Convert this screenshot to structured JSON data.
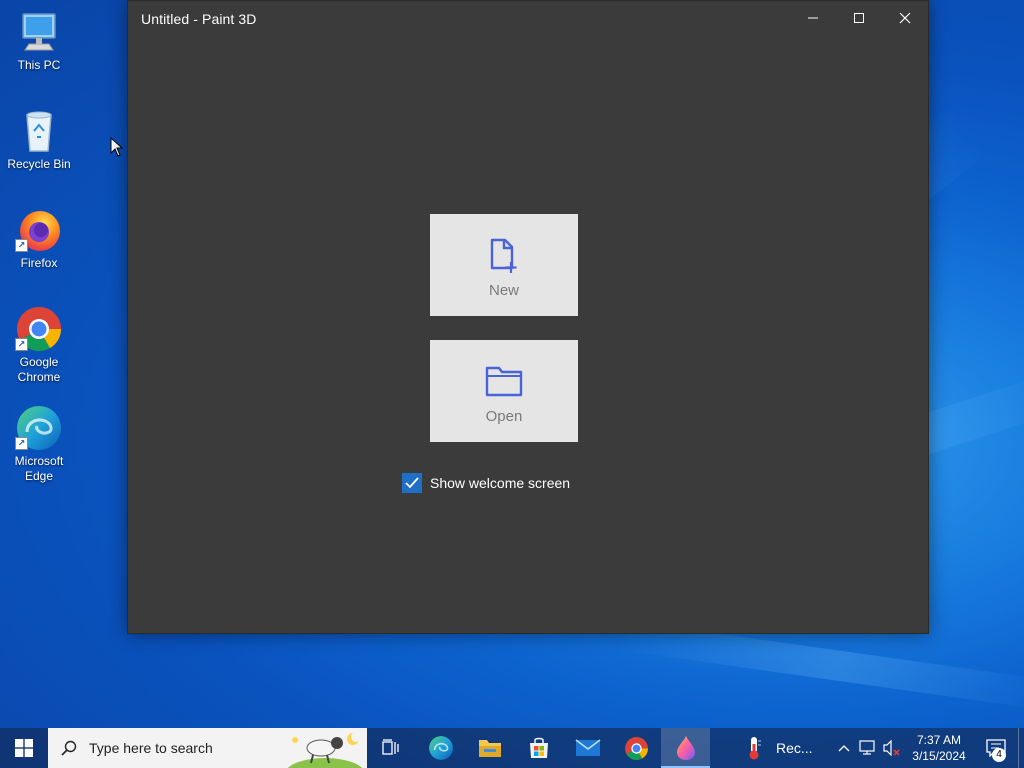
{
  "desktop": {
    "icons": [
      {
        "label": "This PC"
      },
      {
        "label": "Recycle Bin"
      },
      {
        "label": "Firefox"
      },
      {
        "label": "Google Chrome"
      },
      {
        "label": "Microsoft Edge"
      }
    ]
  },
  "window": {
    "title": "Untitled - Paint 3D",
    "new_label": "New",
    "open_label": "Open",
    "show_welcome_label": "Show welcome screen",
    "show_welcome_checked": true
  },
  "taskbar": {
    "search_placeholder": "Type here to search",
    "recorder_label": "Rec...",
    "time": "7:37 AM",
    "date": "3/15/2024",
    "notification_count": "4"
  },
  "colors": {
    "window_bg": "#3b3b3b",
    "tile_bg": "#e5e5e5",
    "accent": "#1f6fc7",
    "icon_accent": "#4a63d8"
  }
}
